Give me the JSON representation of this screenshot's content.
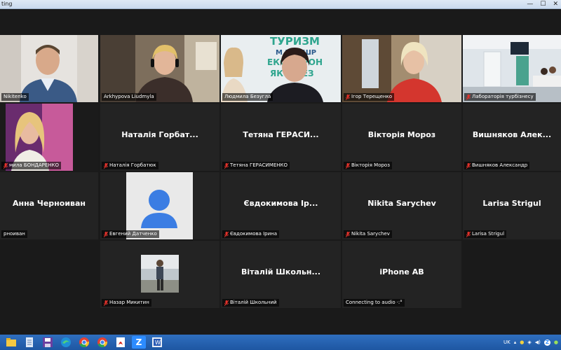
{
  "window": {
    "title": "ting"
  },
  "participants": [
    {
      "label": "Nikitenko",
      "muted": false,
      "video": "man-office"
    },
    {
      "label": "Arkhypova Liudmyla",
      "muted": false,
      "video": "woman-headphones"
    },
    {
      "label": "Людмила Безугла",
      "muted": false,
      "video": "woman-banner",
      "speaking": true,
      "banner_lines": [
        "ТУРИЗМ",
        "М МАРШР",
        "ЕКСК БРОН",
        "ЯК А БЕЗ"
      ]
    },
    {
      "label": "Ігор Терещенко",
      "muted": true,
      "video": "woman-blonde"
    },
    {
      "label": "Лабораторія турбізнесу",
      "muted": true,
      "video": "classroom"
    },
    {
      "label": "мила БОНДАРЕНКО",
      "muted": true,
      "video": "woman-purple"
    },
    {
      "label": "Наталія Горбатюк",
      "center": "Наталія  Горбат...",
      "muted": true
    },
    {
      "label": "Тетяна ГЕРАСИМЕНКО",
      "center": "Тетяна  ГЕРАСИ...",
      "muted": true
    },
    {
      "label": "Вікторія Мороз",
      "center": "Вікторія Мороз",
      "muted": true
    },
    {
      "label": "Вишняков Александр",
      "center": "Вишняков  Алек...",
      "muted": true
    },
    {
      "label": "рноиван",
      "center": "Анна Черноиван",
      "muted": false
    },
    {
      "label": "Евгений Датченко",
      "muted": true,
      "video": "avatar"
    },
    {
      "label": "Євдокимова Ірина",
      "center": "Євдокимова Ір...",
      "muted": true
    },
    {
      "label": "Nikita Sarychev",
      "center": "Nikita Sarychev",
      "muted": true
    },
    {
      "label": "Larisa Strigul",
      "center": "Larisa Strigul",
      "muted": true
    },
    {
      "label": "Назар Микитин",
      "muted": true,
      "video": "man-outdoor"
    },
    {
      "label": "Віталій Школьний",
      "center": "Віталій  Школьн...",
      "muted": true
    },
    {
      "label": "Connecting to audio",
      "center": "iPhone AB",
      "muted": false,
      "connecting": true
    }
  ],
  "taskbar": {
    "icons": [
      "explorer-icon",
      "notepad-icon",
      "save-icon",
      "edge-icon",
      "chrome-icon",
      "chrome-icon-2",
      "pdf-icon",
      "zoom-icon",
      "word-icon"
    ]
  },
  "tray": {
    "language": "UK"
  }
}
